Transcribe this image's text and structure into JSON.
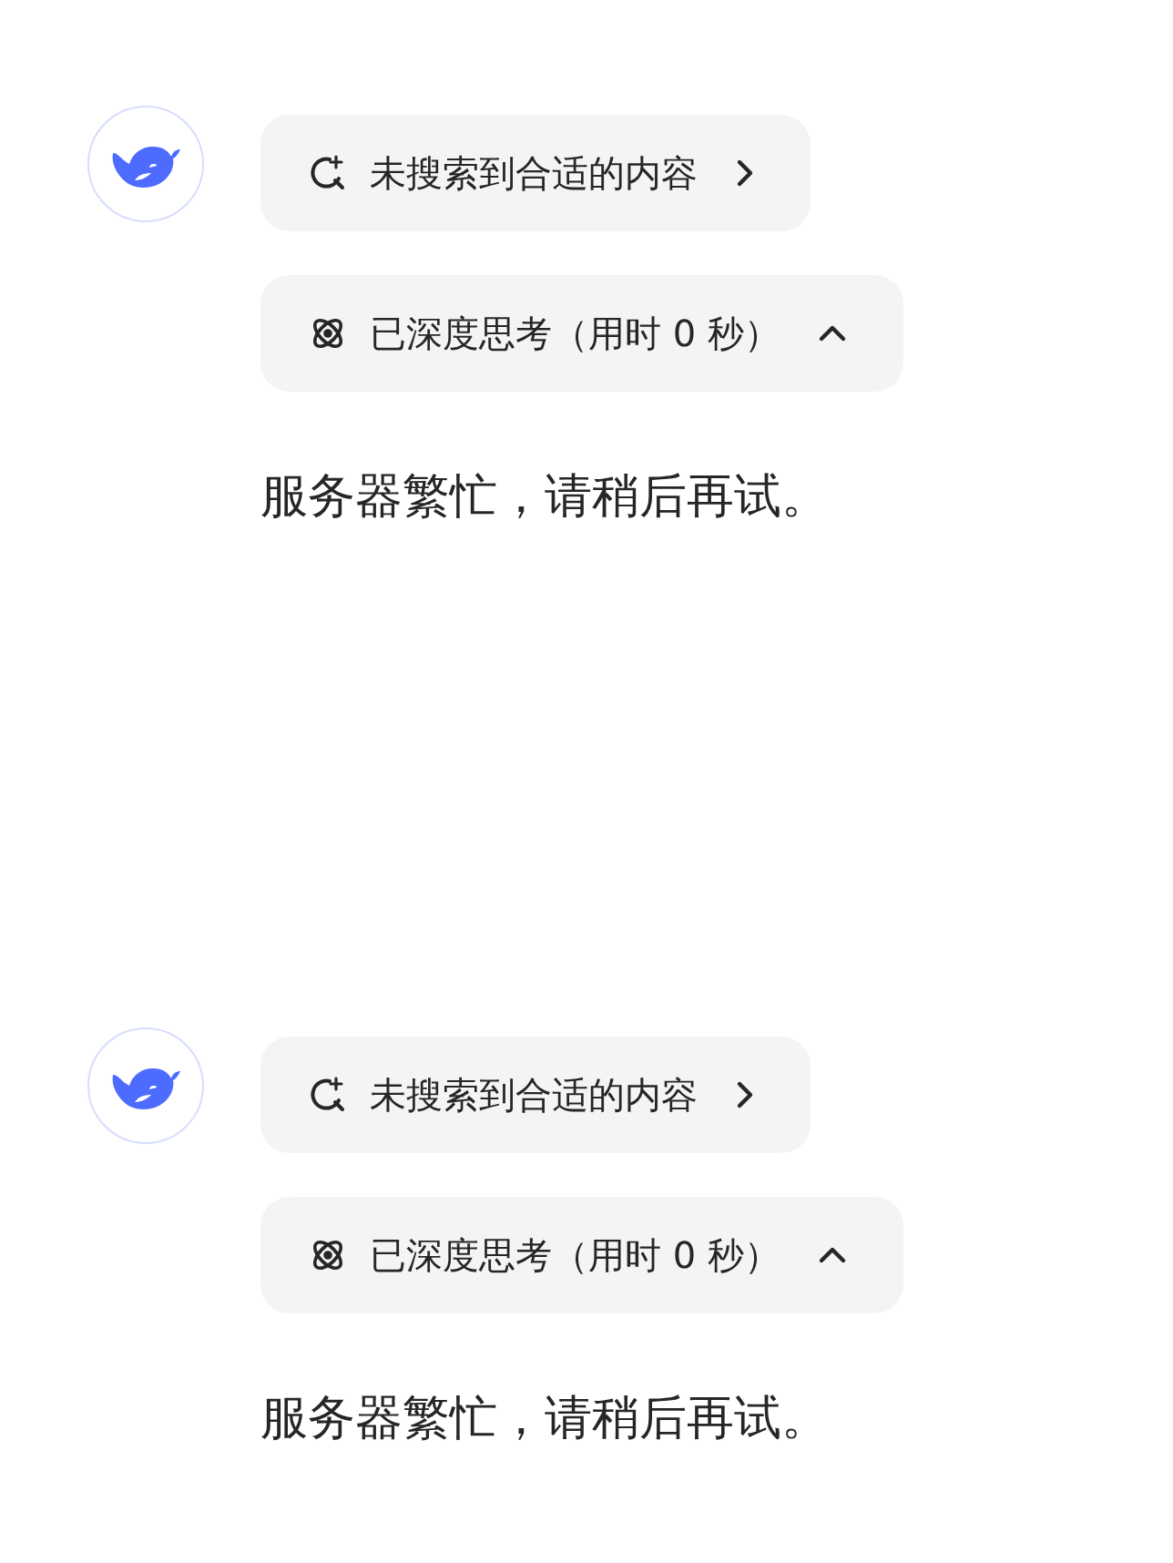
{
  "messages": [
    {
      "search": {
        "label": "未搜索到合适的内容"
      },
      "thinking": {
        "label": "已深度思考（用时 0 秒）",
        "expanded": true
      },
      "answer": "服务器繁忙，请稍后再试。"
    },
    {
      "search": {
        "label": "未搜索到合适的内容"
      },
      "thinking": {
        "label": "已深度思考（用时 0 秒）",
        "expanded": true
      },
      "answer": "服务器繁忙，请稍后再试。"
    }
  ]
}
